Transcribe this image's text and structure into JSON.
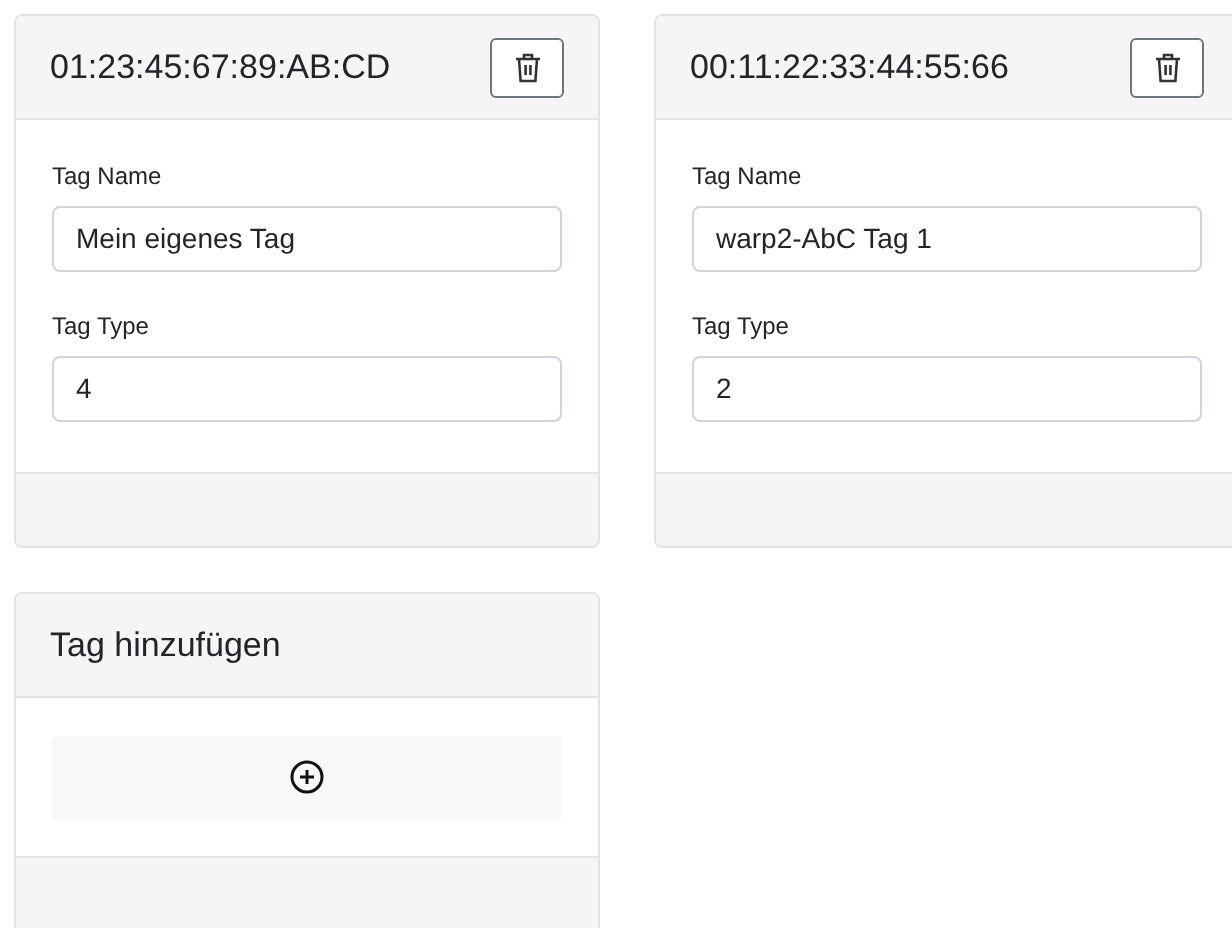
{
  "tags": [
    {
      "title": "01:23:45:67:89:AB:CD",
      "fields": [
        {
          "label": "Tag Name",
          "value": "Mein eigenes Tag"
        },
        {
          "label": "Tag Type",
          "value": "4"
        }
      ]
    },
    {
      "title": "00:11:22:33:44:55:66",
      "fields": [
        {
          "label": "Tag Name",
          "value": "warp2-AbC Tag 1"
        },
        {
          "label": "Tag Type",
          "value": "2"
        }
      ]
    }
  ],
  "add_card": {
    "title": "Tag hinzufügen"
  }
}
